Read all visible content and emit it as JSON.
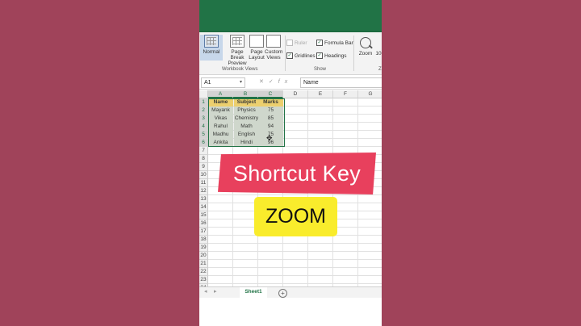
{
  "ribbon": {
    "buttons": [
      {
        "label": "Normal"
      },
      {
        "label": "Page Break Preview"
      },
      {
        "label": "Page Layout"
      },
      {
        "label": "Custom Views"
      }
    ],
    "group_workbook_views": "Workbook Views",
    "checks": {
      "ruler": "Ruler",
      "formula_bar": "Formula Bar",
      "gridlines": "Gridlines",
      "headings": "Headings"
    },
    "group_show": "Show",
    "zoom": "Zoom",
    "zoom_100": "10",
    "group_zoom": "Z"
  },
  "formula_bar": {
    "namebox": "A1",
    "content": "Name"
  },
  "sheet": {
    "columns": [
      "A",
      "B",
      "C",
      "D",
      "E",
      "F",
      "G"
    ],
    "rows": [
      "1",
      "2",
      "3",
      "4",
      "5",
      "6",
      "7",
      "8",
      "9",
      "10",
      "11",
      "12",
      "13",
      "14",
      "15",
      "16",
      "17",
      "18",
      "19",
      "20",
      "21",
      "22",
      "23",
      "24"
    ],
    "table_header": [
      "Name",
      "Subject",
      "Marks"
    ],
    "table_rows": [
      [
        "Mayank",
        "Physics",
        "75"
      ],
      [
        "Vikas",
        "Chemistry",
        "85"
      ],
      [
        "Rahul",
        "Math",
        "94"
      ],
      [
        "Madhu",
        "English",
        "75"
      ],
      [
        "Ankita",
        "Hindi",
        "96"
      ]
    ]
  },
  "tabs": {
    "sheet1": "Sheet1",
    "add": "+"
  },
  "overlay": {
    "title": "Shortcut Key",
    "subtitle": "ZOOM"
  },
  "colors": {
    "excel_green": "#217346",
    "banner_red": "#e8405d",
    "banner_yellow": "#f9ec2c",
    "header_fill": "#ffd966",
    "background": "#9c3f52"
  }
}
